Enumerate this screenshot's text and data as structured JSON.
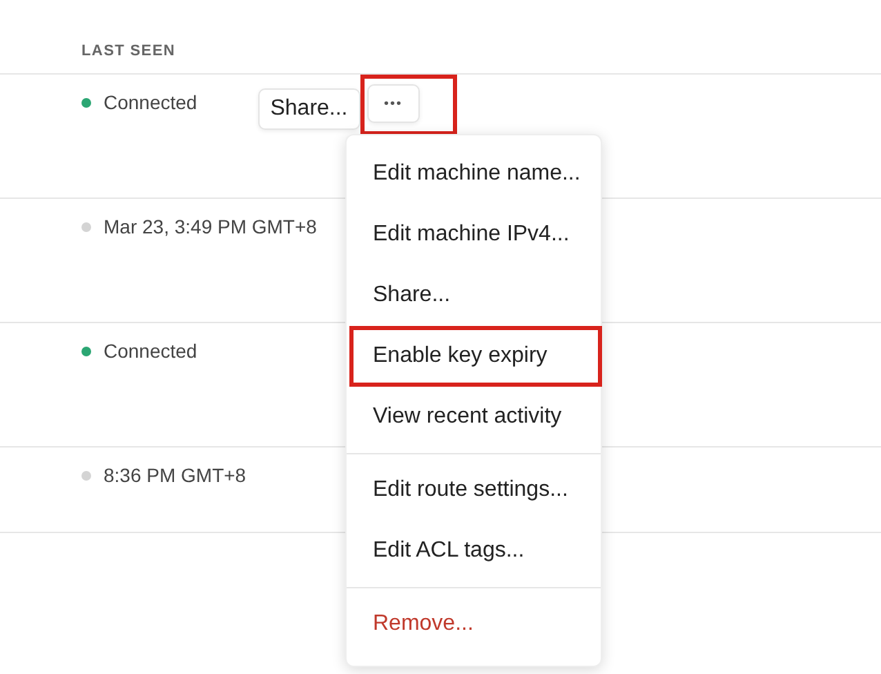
{
  "table": {
    "columns": [
      {
        "label": "LAST SEEN"
      }
    ],
    "rows": [
      {
        "status": "Connected",
        "color": "#2ba673",
        "actions": {
          "share": "Share...",
          "more": "•••",
          "highlighted": true
        }
      },
      {
        "status": "Mar 23, 3:49 PM GMT+8",
        "color": "#d4d4d4"
      },
      {
        "status": "Connected",
        "color": "#2ba673"
      },
      {
        "status": "8:36 PM GMT+8",
        "color": "#d4d4d4"
      }
    ]
  },
  "menu": {
    "groups": [
      [
        {
          "label": "Edit machine name...",
          "kind": "normal",
          "highlighted": false
        },
        {
          "label": "Edit machine IPv4...",
          "kind": "normal",
          "highlighted": false
        },
        {
          "label": "Share...",
          "kind": "normal",
          "highlighted": false
        },
        {
          "label": "Enable key expiry",
          "kind": "normal",
          "highlighted": true
        },
        {
          "label": "View recent activity",
          "kind": "normal",
          "highlighted": false
        }
      ],
      [
        {
          "label": "Edit route settings...",
          "kind": "normal",
          "highlighted": false
        },
        {
          "label": "Edit ACL tags...",
          "kind": "normal",
          "highlighted": false
        }
      ],
      [
        {
          "label": "Remove...",
          "kind": "danger",
          "highlighted": false
        }
      ]
    ]
  }
}
